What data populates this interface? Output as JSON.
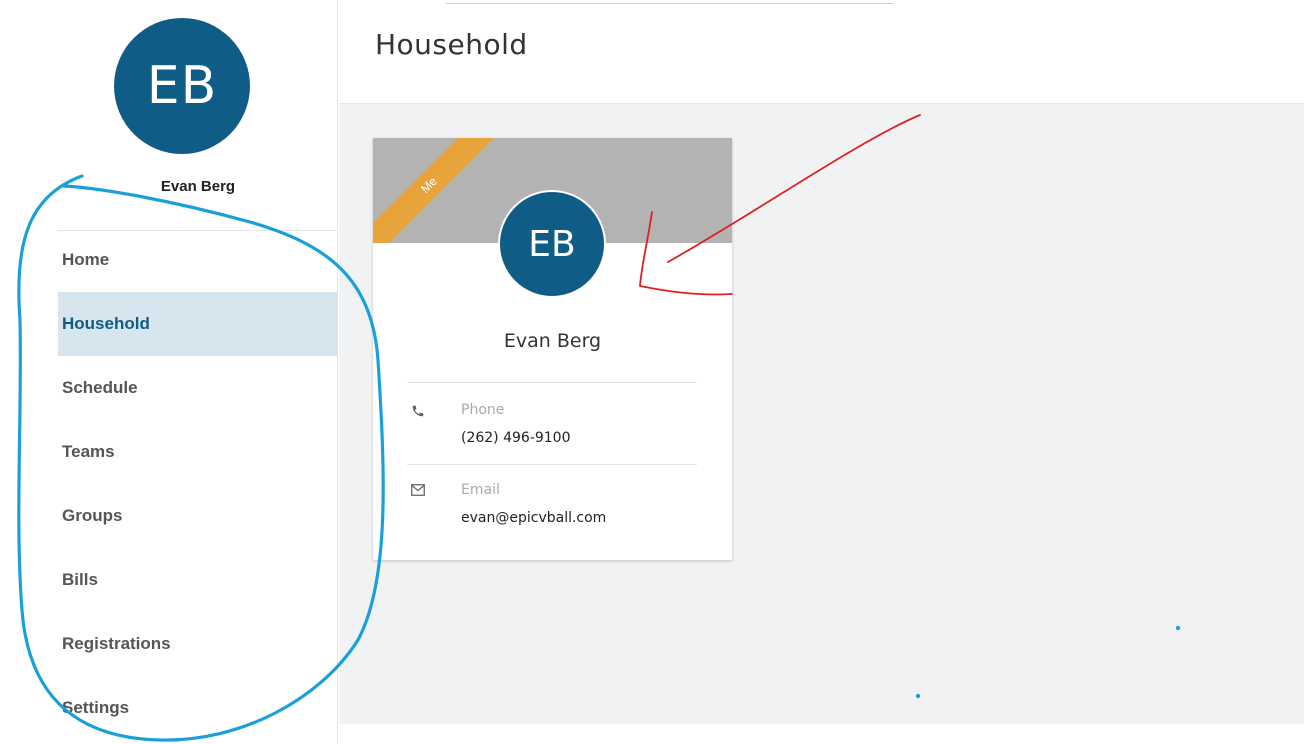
{
  "user": {
    "initials": "EB",
    "name": "Evan Berg"
  },
  "nav": {
    "items": [
      {
        "label": "Home"
      },
      {
        "label": "Household",
        "active": true
      },
      {
        "label": "Schedule"
      },
      {
        "label": "Teams"
      },
      {
        "label": "Groups"
      },
      {
        "label": "Bills"
      },
      {
        "label": "Registrations"
      },
      {
        "label": "Settings"
      }
    ]
  },
  "header": {
    "title": "Household"
  },
  "card": {
    "ribbon": "Me",
    "initials": "EB",
    "name": "Evan Berg",
    "phone": {
      "label": "Phone",
      "value": "(262) 496-9100",
      "icon": "phone-icon"
    },
    "email": {
      "label": "Email",
      "value": "evan@epicvball.com",
      "icon": "envelope-icon"
    }
  },
  "colors": {
    "brand": "#0f5d86",
    "nav_active_bg": "#d6e5ee",
    "ribbon": "#e8a43a",
    "banner": "#b3b3b3",
    "annotation_blue": "#1aa0d8",
    "annotation_red": "#e02020"
  }
}
